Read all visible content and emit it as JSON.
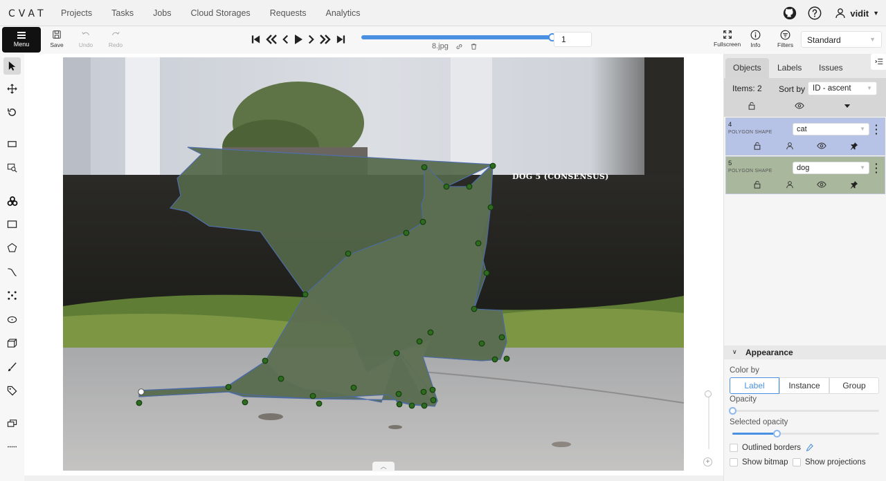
{
  "app": {
    "logo": "CVAT"
  },
  "nav": [
    "Projects",
    "Tasks",
    "Jobs",
    "Cloud Storages",
    "Requests",
    "Analytics"
  ],
  "user": {
    "name": "vidit"
  },
  "toolbar": {
    "menu": "Menu",
    "save": "Save",
    "undo": "Undo",
    "redo": "Redo",
    "frame": "1",
    "frame_progress_percent": 100,
    "filename": "8.jpg",
    "fullscreen": "Fullscreen",
    "info": "Info",
    "filters": "Filters",
    "workspace": "Standard"
  },
  "canvas": {
    "object_label": "DOG 5 (CONSENSUS)"
  },
  "sidebar": {
    "tabs": [
      "Objects",
      "Labels",
      "Issues"
    ],
    "items_count": "Items: 2",
    "sort_by_label": "Sort by",
    "sort_by_value": "ID - ascent",
    "objects": [
      {
        "id": "4",
        "kind": "POLYGON SHAPE",
        "label": "cat",
        "color": "#b6c2e6"
      },
      {
        "id": "5",
        "kind": "POLYGON SHAPE",
        "label": "dog",
        "color": "#a9b89d"
      }
    ]
  },
  "appearance": {
    "title": "Appearance",
    "color_by_label": "Color by",
    "color_by_options": [
      "Label",
      "Instance",
      "Group"
    ],
    "color_by_selected": "Label",
    "opacity_label": "Opacity",
    "opacity_value": 0,
    "selected_opacity_label": "Selected opacity",
    "selected_opacity_value": 0.3,
    "outlined_borders": "Outlined borders",
    "show_bitmap": "Show bitmap",
    "show_projections": "Show projections"
  }
}
